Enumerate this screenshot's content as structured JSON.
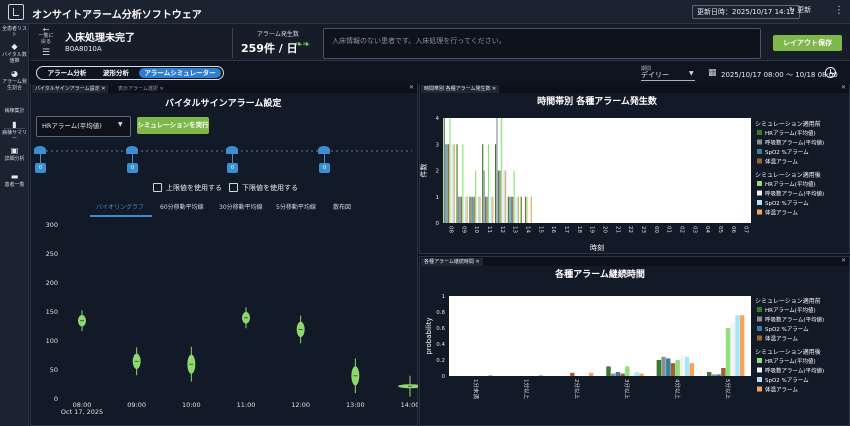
{
  "app": {
    "title": "オンサイトアラーム分析ソフトウェア",
    "updated": "更新日時：2025/10/17 14:12",
    "refresh_label": "更新"
  },
  "sidebar": {
    "items": [
      {
        "label": "全患者リスト",
        "icon": "list-icon"
      },
      {
        "label": "バイタル数値推",
        "icon": "vitals-icon"
      },
      {
        "label": "アラーム発生割合",
        "icon": "pie-icon"
      },
      {
        "label": "病棟集計",
        "icon": "ward-icon"
      },
      {
        "label": "病棟サマリー",
        "icon": "bar-icon"
      },
      {
        "label": "詳細分析",
        "icon": "detail-icon"
      },
      {
        "label": "患者一覧",
        "icon": "bed-icon"
      }
    ]
  },
  "header": {
    "back_label": "一覧に戻る",
    "patient_status": "入床処理未完了",
    "patient_id": "B0A8010A",
    "alarm_count_label": "アラーム発生数",
    "alarm_count": "259件 / 日",
    "message": "入床情報のない患者です。入床処理を行ってください。",
    "save_label": "レイアウト保存"
  },
  "mode_tabs": [
    "アラーム分析",
    "波形分析",
    "アラームシミュレーター"
  ],
  "active_mode": 2,
  "period": {
    "label": "期間",
    "value": "デイリー",
    "range": "2025/10/17 08:00 〜 10/18 08:00"
  },
  "left_panel": {
    "tabs": [
      "バイタルサインアラーム設定",
      "表示アラーム選択"
    ],
    "title": "バイタルサインアラーム設定",
    "select_value": "HRアラーム(平均値)",
    "sim_button": "シミュレーションを実行",
    "slider_values": [
      "0",
      "0",
      "0",
      "0"
    ],
    "upper_label": "上限値を使用する",
    "lower_label": "下限値を使用する",
    "view_tabs": [
      "バイオリングラフ",
      "60分移動平均線",
      "30分移動平均線",
      "5分移動平均線",
      "散布図"
    ]
  },
  "violin_chart": {
    "yticks": [
      "0",
      "50",
      "100",
      "150",
      "200",
      "250",
      "300"
    ],
    "xticks": [
      "08:00",
      "09:00",
      "10:00",
      "11:00",
      "12:00",
      "13:00",
      "14:00"
    ],
    "date_label": "Oct 17, 2025",
    "color": "#8fd86f",
    "medians": [
      135,
      65,
      60,
      140,
      120,
      40,
      22
    ]
  },
  "chart_data": [
    {
      "type": "bar",
      "title": "時間帯別 各種アラーム発生数",
      "tab_label": "時間帯別 各種アラーム発生数",
      "xlabel": "時刻",
      "ylabel": "件数",
      "ylim": [
        0,
        4
      ],
      "yticks": [
        "0",
        "1",
        "2",
        "3",
        "4"
      ],
      "categories": [
        "08",
        "09",
        "10",
        "11",
        "12",
        "13",
        "14",
        "15",
        "16",
        "17",
        "18",
        "19",
        "20",
        "21",
        "22",
        "23",
        "00",
        "01",
        "02",
        "03",
        "04",
        "05",
        "06",
        "07"
      ],
      "legend_group1": "シミュレーション適用前",
      "legend_group2": "シミュレーション適用後",
      "series": [
        {
          "name": "HRアラーム(平均値)",
          "group": "before",
          "color": "#3a7a2c",
          "values": [
            4,
            3,
            1,
            3,
            3,
            1,
            1,
            0,
            0,
            0,
            0,
            0,
            0,
            0,
            0,
            0,
            0,
            0,
            0,
            0,
            0,
            0,
            0,
            0
          ]
        },
        {
          "name": "呼吸数アラーム(平均値)",
          "group": "before",
          "color": "#8a8f96",
          "values": [
            3,
            1,
            1,
            2,
            4,
            1,
            0,
            0,
            0,
            0,
            0,
            0,
            0,
            0,
            0,
            0,
            0,
            0,
            0,
            0,
            0,
            0,
            0,
            0
          ]
        },
        {
          "name": "SpO2 %アラーム",
          "group": "before",
          "color": "#3d7e9e",
          "values": [
            3,
            1,
            1,
            1,
            2,
            1,
            0,
            0,
            0,
            0,
            0,
            0,
            0,
            0,
            0,
            0,
            0,
            0,
            0,
            0,
            0,
            0,
            0,
            0
          ]
        },
        {
          "name": "体温アラーム",
          "group": "before",
          "color": "#9a6433",
          "values": [
            3,
            1,
            1,
            1,
            2,
            1,
            1,
            0,
            0,
            0,
            0,
            0,
            0,
            0,
            0,
            0,
            0,
            0,
            0,
            0,
            0,
            0,
            0,
            0
          ]
        },
        {
          "name": "HRアラーム(平均値)",
          "group": "after",
          "color": "#8fe07a",
          "values": [
            4,
            3,
            2,
            3,
            4,
            2,
            1,
            0,
            0,
            0,
            0,
            0,
            0,
            0,
            0,
            0,
            0,
            0,
            0,
            0,
            0,
            0,
            0,
            0
          ]
        },
        {
          "name": "呼吸数アラーム(平均値)",
          "group": "after",
          "color": "#f2f2f2",
          "values": [
            3,
            1,
            1,
            2,
            4,
            1,
            0,
            0,
            0,
            0,
            0,
            0,
            0,
            0,
            0,
            0,
            0,
            0,
            0,
            0,
            0,
            0,
            0,
            0
          ]
        },
        {
          "name": "SpO2 %アラーム",
          "group": "after",
          "color": "#a9e4f7",
          "values": [
            3,
            1,
            1,
            1,
            2,
            1,
            0,
            0,
            0,
            0,
            0,
            0,
            0,
            0,
            0,
            0,
            0,
            0,
            0,
            0,
            0,
            0,
            0,
            0
          ]
        },
        {
          "name": "体温アラーム",
          "group": "after",
          "color": "#f5a35c",
          "values": [
            3,
            1,
            1,
            1,
            2,
            1,
            1,
            0,
            0,
            0,
            0,
            0,
            0,
            0,
            0,
            0,
            0,
            0,
            0,
            0,
            0,
            0,
            0,
            0
          ]
        }
      ]
    },
    {
      "type": "bar",
      "title": "各種アラーム継続時間",
      "tab_label": "各種アラーム継続時間",
      "ylabel": "probability",
      "ylim": [
        0,
        1
      ],
      "yticks": [
        "0",
        "0.2",
        "0.4",
        "0.6",
        "0.8",
        "1"
      ],
      "categories": [
        "1分未満",
        "1分以上",
        "2分以上",
        "3分以上",
        "4分以上",
        "5分以上"
      ],
      "legend_group1": "シミュレーション適用前",
      "legend_group2": "シミュレーション適用後",
      "series": [
        {
          "name": "HRアラーム(平均値)",
          "group": "before",
          "color": "#3a7a2c",
          "values": [
            0,
            0,
            0,
            0.12,
            0.2,
            0.05
          ]
        },
        {
          "name": "呼吸数アラーム(平均値)",
          "group": "before",
          "color": "#8a8f96",
          "values": [
            0,
            0,
            0,
            0.03,
            0.24,
            0.02
          ]
        },
        {
          "name": "SpO2 %アラーム",
          "group": "before",
          "color": "#3d7e9e",
          "values": [
            0,
            0,
            0,
            0.05,
            0.22,
            0.02
          ]
        },
        {
          "name": "体温アラーム",
          "group": "before",
          "color": "#9a6433",
          "values": [
            0,
            0,
            0.04,
            0.03,
            0.16,
            0.1
          ]
        },
        {
          "name": "HRアラーム(平均値)",
          "group": "after",
          "color": "#8fe07a",
          "values": [
            0,
            0,
            0,
            0.12,
            0.2,
            0.6
          ]
        },
        {
          "name": "呼吸数アラーム(平均値)",
          "group": "after",
          "color": "#f2f2f2",
          "values": [
            0,
            0,
            0,
            0.03,
            0.26,
            0.66
          ]
        },
        {
          "name": "SpO2 %アラーム",
          "group": "after",
          "color": "#a9e4f7",
          "values": [
            0,
            0,
            0,
            0.05,
            0.24,
            0.76
          ]
        },
        {
          "name": "体温アラーム",
          "group": "after",
          "color": "#f5a35c",
          "values": [
            0.01,
            0.01,
            0.04,
            0.03,
            0.16,
            0.76
          ]
        }
      ]
    }
  ]
}
